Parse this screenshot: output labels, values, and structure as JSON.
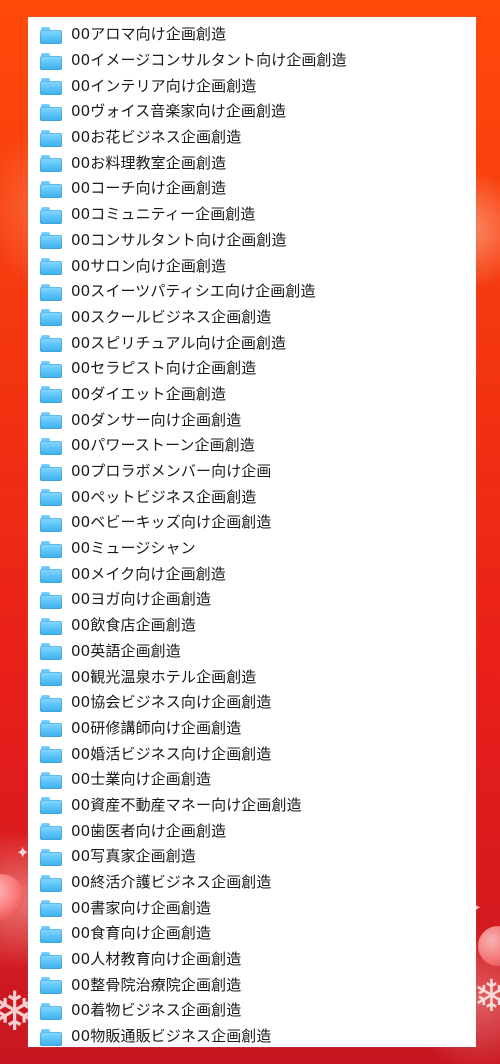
{
  "window": {
    "style": "finder-file-list"
  },
  "background": {
    "theme": "christmas-red",
    "accent": "#e81e1a",
    "decorations": [
      "snowflake-icon",
      "snowflake-icon",
      "ornament-icon",
      "ornament-icon",
      "sparkle-icon"
    ]
  },
  "folders": [
    {
      "name": "00アロマ向け企画創造",
      "icon": "folder-icon"
    },
    {
      "name": "00イメージコンサルタント向け企画創造",
      "icon": "folder-icon"
    },
    {
      "name": "00インテリア向け企画創造",
      "icon": "folder-icon"
    },
    {
      "name": "00ヴォイス音楽家向け企画創造",
      "icon": "folder-icon"
    },
    {
      "name": "00お花ビジネス企画創造",
      "icon": "folder-icon"
    },
    {
      "name": "00お料理教室企画創造",
      "icon": "folder-icon"
    },
    {
      "name": "00コーチ向け企画創造",
      "icon": "folder-icon"
    },
    {
      "name": "00コミュニティー企画創造",
      "icon": "folder-icon"
    },
    {
      "name": "00コンサルタント向け企画創造",
      "icon": "folder-icon"
    },
    {
      "name": "00サロン向け企画創造",
      "icon": "folder-icon"
    },
    {
      "name": "00スイーツパティシエ向け企画創造",
      "icon": "folder-icon"
    },
    {
      "name": "00スクールビジネス企画創造",
      "icon": "folder-icon"
    },
    {
      "name": "00スピリチュアル向け企画創造",
      "icon": "folder-icon"
    },
    {
      "name": "00セラピスト向け企画創造",
      "icon": "folder-icon"
    },
    {
      "name": "00ダイエット企画創造",
      "icon": "folder-icon"
    },
    {
      "name": "00ダンサー向け企画創造",
      "icon": "folder-icon"
    },
    {
      "name": "00パワーストーン企画創造",
      "icon": "folder-icon"
    },
    {
      "name": "00プロラボメンバー向け企画",
      "icon": "folder-icon"
    },
    {
      "name": "00ペットビジネス企画創造",
      "icon": "folder-icon"
    },
    {
      "name": "00ベビーキッズ向け企画創造",
      "icon": "folder-icon"
    },
    {
      "name": "00ミュージシャン",
      "icon": "folder-icon"
    },
    {
      "name": "00メイク向け企画創造",
      "icon": "folder-icon"
    },
    {
      "name": "00ヨガ向け企画創造",
      "icon": "folder-icon"
    },
    {
      "name": "00飲食店企画創造",
      "icon": "folder-icon"
    },
    {
      "name": "00英語企画創造",
      "icon": "folder-icon"
    },
    {
      "name": "00観光温泉ホテル企画創造",
      "icon": "folder-icon"
    },
    {
      "name": "00協会ビジネス向け企画創造",
      "icon": "folder-icon"
    },
    {
      "name": "00研修講師向け企画創造",
      "icon": "folder-icon"
    },
    {
      "name": "00婚活ビジネス向け企画創造",
      "icon": "folder-icon"
    },
    {
      "name": "00士業向け企画創造",
      "icon": "folder-icon"
    },
    {
      "name": "00資産不動産マネー向け企画創造",
      "icon": "folder-icon"
    },
    {
      "name": "00歯医者向け企画創造",
      "icon": "folder-icon"
    },
    {
      "name": "00写真家企画創造",
      "icon": "folder-icon"
    },
    {
      "name": "00終活介護ビジネス企画創造",
      "icon": "folder-icon"
    },
    {
      "name": "00書家向け企画創造",
      "icon": "folder-icon"
    },
    {
      "name": "00食育向け企画創造",
      "icon": "folder-icon"
    },
    {
      "name": "00人材教育向け企画創造",
      "icon": "folder-icon"
    },
    {
      "name": "00整骨院治療院企画創造",
      "icon": "folder-icon"
    },
    {
      "name": "00着物ビジネス企画創造",
      "icon": "folder-icon"
    },
    {
      "name": "00物販通販ビジネス企画創造",
      "icon": "folder-icon"
    }
  ]
}
